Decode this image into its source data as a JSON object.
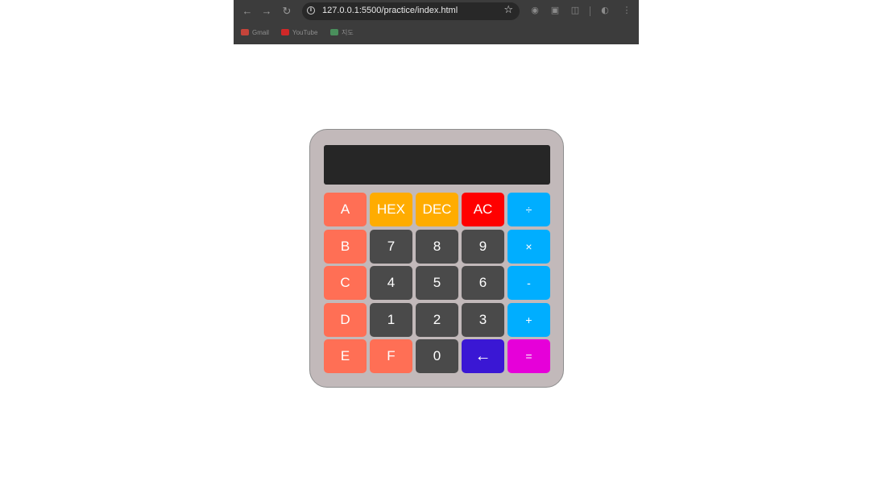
{
  "browser": {
    "url": "127.0.0.1:5500/practice/index.html",
    "nav": {
      "back": "←",
      "forward": "→",
      "reload": "↻"
    },
    "bookmarks": [
      {
        "label": "Gmail",
        "color": "#c5443a"
      },
      {
        "label": "YouTube",
        "color": "#d02828"
      },
      {
        "label": "지도",
        "color": "#4a8f5c"
      }
    ]
  },
  "calculator": {
    "display_value": "",
    "colors": {
      "body": "#c2b9ba",
      "display": "#262626",
      "hex_digit": "#ff6f55",
      "mode": "#ffac00",
      "clear": "#ff0000",
      "operator": "#00aeff",
      "number": "#4a4a4a",
      "backspace": "#3a17d4",
      "equals": "#e600d9"
    },
    "keys": {
      "a": "A",
      "hex": "HEX",
      "dec": "DEC",
      "ac": "AC",
      "divide": "÷",
      "b": "B",
      "seven": "7",
      "eight": "8",
      "nine": "9",
      "multiply": "×",
      "c": "C",
      "four": "4",
      "five": "5",
      "six": "6",
      "minus": "-",
      "d": "D",
      "one": "1",
      "two": "2",
      "three": "3",
      "plus": "+",
      "e": "E",
      "f": "F",
      "zero": "0",
      "backspace": "←",
      "equals": "="
    }
  }
}
